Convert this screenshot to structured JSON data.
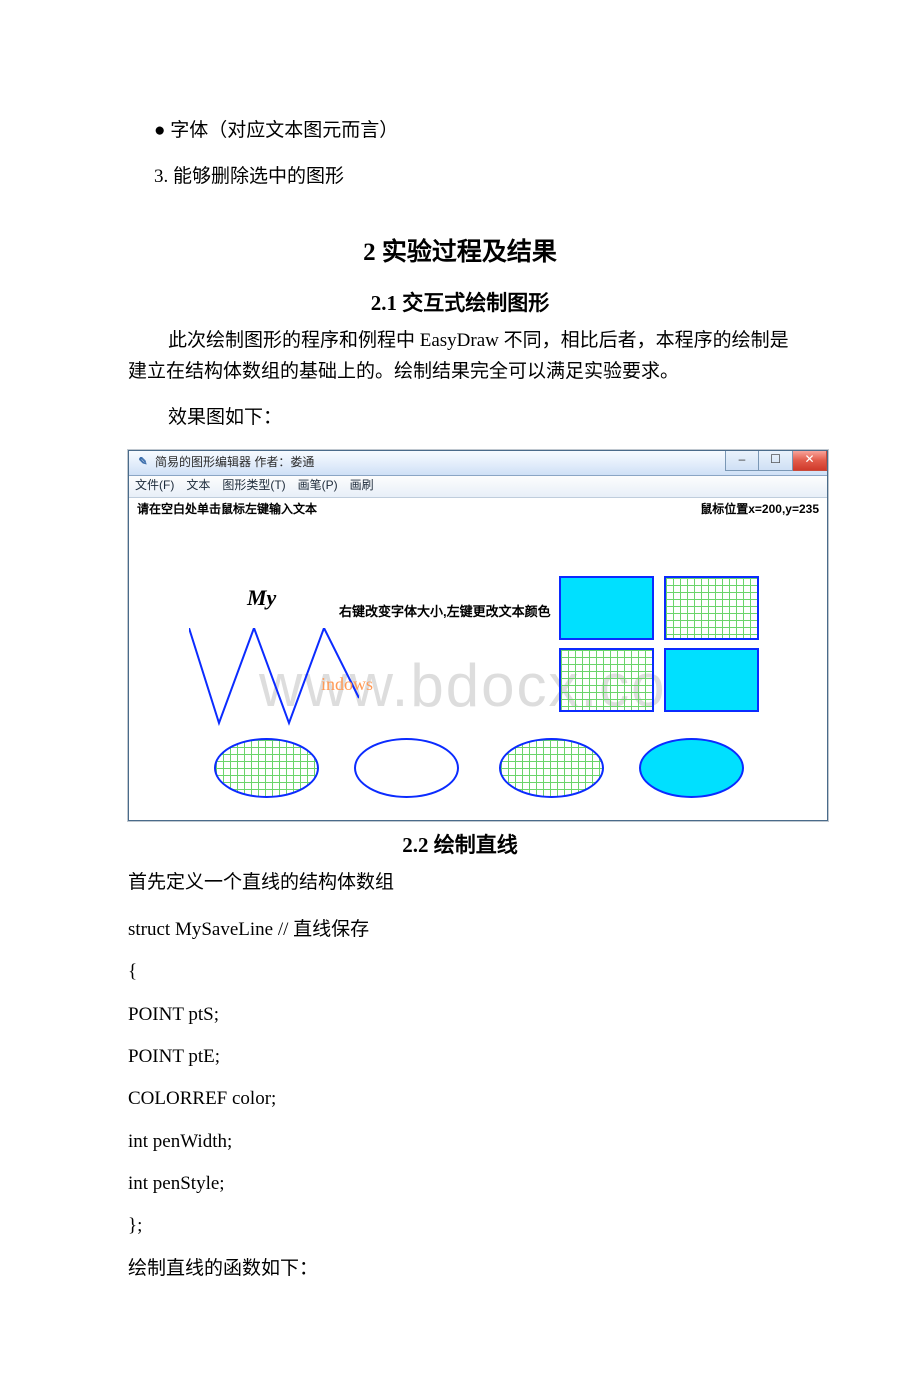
{
  "bullet_font": "● 字体（对应文本图元而言）",
  "item3": "3. 能够删除选中的图形",
  "h1": "2 实验过程及结果",
  "h2_1": "2.1 交互式绘制图形",
  "p_intro": "此次绘制图形的程序和例程中 EasyDraw 不同，相比后者，本程序的绘制是建立在结构体数组的基础上的。绘制结果完全可以满足实验要求。",
  "p_effect": "效果图如下：",
  "window": {
    "title": "简易的图形编辑器 作者：娄通",
    "menu": {
      "file": "文件(F)",
      "text": "文本",
      "shape": "图形类型(T)",
      "pen": "画笔(P)",
      "brush": "画刷"
    },
    "hint_left": "请在空白处单击鼠标左键输入文本",
    "hint_right": "鼠标位置x=200,y=235",
    "canvas": {
      "my": "My",
      "hint": "右键改变字体大小,左键更改文本颜色",
      "indows": "indows",
      "watermark": "www.bdocx.com"
    },
    "buttons": {
      "min": "–",
      "max": "☐",
      "close": "✕"
    }
  },
  "h2_2": "2.2 绘制直线",
  "p_struct_intro": "首先定义一个直线的结构体数组",
  "code": {
    "l1": "struct MySaveLine  // 直线保存",
    "l2": "{",
    "l3": " POINT ptS;",
    "l4": " POINT ptE;",
    "l5": " COLORREF color;",
    "l6": " int penWidth;",
    "l7": " int penStyle;",
    "l8": "};"
  },
  "p_func": "绘制直线的函数如下："
}
